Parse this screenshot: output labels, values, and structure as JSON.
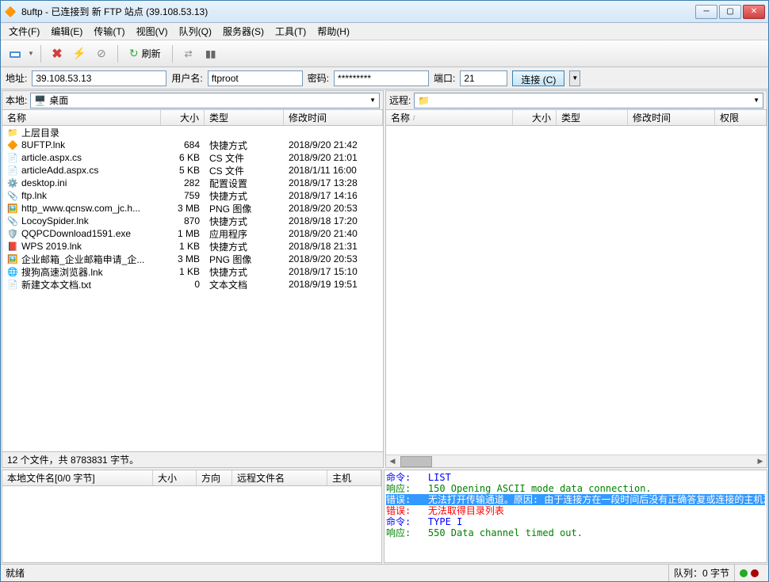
{
  "window": {
    "title": "8uftp - 已连接到 新 FTP 站点 (39.108.53.13)"
  },
  "menu": {
    "file": "文件(F)",
    "edit": "编辑(E)",
    "transfer": "传输(T)",
    "view": "视图(V)",
    "queue": "队列(Q)",
    "server": "服务器(S)",
    "tools": "工具(T)",
    "help": "帮助(H)"
  },
  "toolbar": {
    "refresh": "刷新"
  },
  "conn": {
    "addr_label": "地址:",
    "addr": "39.108.53.13",
    "user_label": "用户名:",
    "user": "ftproot",
    "pass_label": "密码:",
    "pass": "*********",
    "port_label": "端口:",
    "port": "21",
    "connect": "连接 (C)"
  },
  "local": {
    "label": "本地:",
    "path": "桌面",
    "cols": {
      "name": "名称",
      "size": "大小",
      "type": "类型",
      "mtime": "修改时间"
    },
    "updir": "上层目录",
    "files": [
      {
        "icon": "ftp",
        "name": "8UFTP.lnk",
        "size": "684",
        "type": "快捷方式",
        "mtime": "2018/9/20 21:42"
      },
      {
        "icon": "cs",
        "name": "article.aspx.cs",
        "size": "6 KB",
        "type": "CS 文件",
        "mtime": "2018/9/20 21:01"
      },
      {
        "icon": "cs",
        "name": "articleAdd.aspx.cs",
        "size": "5 KB",
        "type": "CS 文件",
        "mtime": "2018/1/11 16:00"
      },
      {
        "icon": "ini",
        "name": "desktop.ini",
        "size": "282",
        "type": "配置设置",
        "mtime": "2018/9/17 13:28"
      },
      {
        "icon": "lnk",
        "name": "ftp.lnk",
        "size": "759",
        "type": "快捷方式",
        "mtime": "2018/9/17 14:16"
      },
      {
        "icon": "png",
        "name": "http_www.qcnsw.com_jc.h...",
        "size": "3 MB",
        "type": "PNG 图像",
        "mtime": "2018/9/20 20:53"
      },
      {
        "icon": "lnk",
        "name": "LocoySpider.lnk",
        "size": "870",
        "type": "快捷方式",
        "mtime": "2018/9/18 17:20"
      },
      {
        "icon": "exe",
        "name": "QQPCDownload1591.exe",
        "size": "1 MB",
        "type": "应用程序",
        "mtime": "2018/9/20 21:40"
      },
      {
        "icon": "wps",
        "name": "WPS 2019.lnk",
        "size": "1 KB",
        "type": "快捷方式",
        "mtime": "2018/9/18 21:31"
      },
      {
        "icon": "png",
        "name": "企业邮箱_企业邮箱申请_企...",
        "size": "3 MB",
        "type": "PNG 图像",
        "mtime": "2018/9/20 20:53"
      },
      {
        "icon": "brw",
        "name": "搜狗高速浏览器.lnk",
        "size": "1 KB",
        "type": "快捷方式",
        "mtime": "2018/9/17 15:10"
      },
      {
        "icon": "txt",
        "name": "新建文本文档.txt",
        "size": "0",
        "type": "文本文档",
        "mtime": "2018/9/19 19:51"
      }
    ],
    "summary": "12 个文件，共 8783831 字节。"
  },
  "remote": {
    "label": "远程:",
    "cols": {
      "name": "名称",
      "size": "大小",
      "type": "类型",
      "mtime": "修改时间",
      "perm": "权限"
    }
  },
  "queue": {
    "cols": {
      "name": "本地文件名[0/0 字节]",
      "size": "大小",
      "dir": "方向",
      "remote": "远程文件名",
      "host": "主机"
    }
  },
  "log": [
    {
      "cls": "cmd",
      "lbl": "命令:",
      "txt": "LIST"
    },
    {
      "cls": "resp",
      "lbl": "响应:",
      "txt": "150 Opening ASCII mode data connection."
    },
    {
      "cls": "errsel",
      "lbl": "错误:",
      "txt": "无法打开传输通道。原因: 由于连接方在一段时间后没有正确答复或连接的主机没有反应，连接尝试失败。"
    },
    {
      "cls": "err",
      "lbl": "错误:",
      "txt": "无法取得目录列表"
    },
    {
      "cls": "cmd",
      "lbl": "命令:",
      "txt": "TYPE I"
    },
    {
      "cls": "resp",
      "lbl": "响应:",
      "txt": "550 Data channel timed out."
    }
  ],
  "status": {
    "ready": "就绪",
    "queue": "队列：0 字节"
  }
}
